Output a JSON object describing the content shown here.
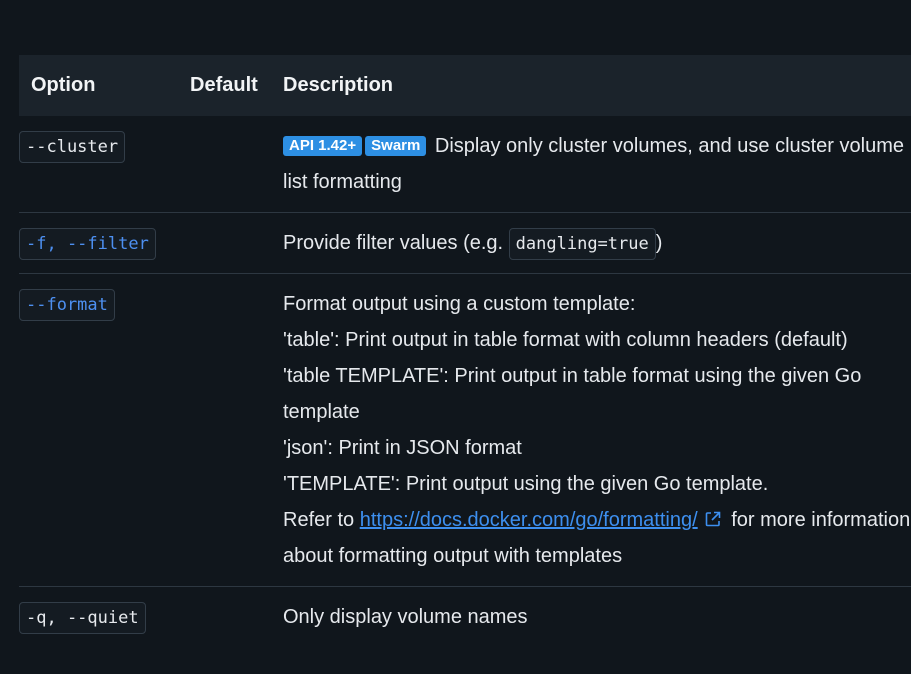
{
  "headers": {
    "option": "Option",
    "default": "Default",
    "description": "Description"
  },
  "rows": [
    {
      "option": "--cluster",
      "badges": [
        "API 1.42+",
        "Swarm"
      ],
      "description": "Display only cluster volumes, and use cluster volume list formatting"
    },
    {
      "option": "-f, --filter",
      "description_prefix": "Provide filter values (e.g.",
      "code": "dangling=true",
      "description_suffix": ")"
    },
    {
      "option": "--format",
      "lines": [
        "Format output using a custom template:",
        "'table': Print output in table format with column headers (default)",
        "'table TEMPLATE': Print output in table format using the given Go template",
        "'json': Print in JSON format",
        "'TEMPLATE': Print output using the given Go template."
      ],
      "refer_prefix": "Refer to",
      "link_text": "https://docs.docker.com/go/formatting/",
      "refer_suffix": "for more information about formatting output with templates"
    },
    {
      "option": "-q, --quiet",
      "description": "Only display volume names"
    }
  ],
  "icons": {
    "external_link": "external-link-icon"
  },
  "colors": {
    "background": "#10161c",
    "header_bg": "#1b232b",
    "badge": "#2d8fe3",
    "link": "#3d8fef"
  }
}
